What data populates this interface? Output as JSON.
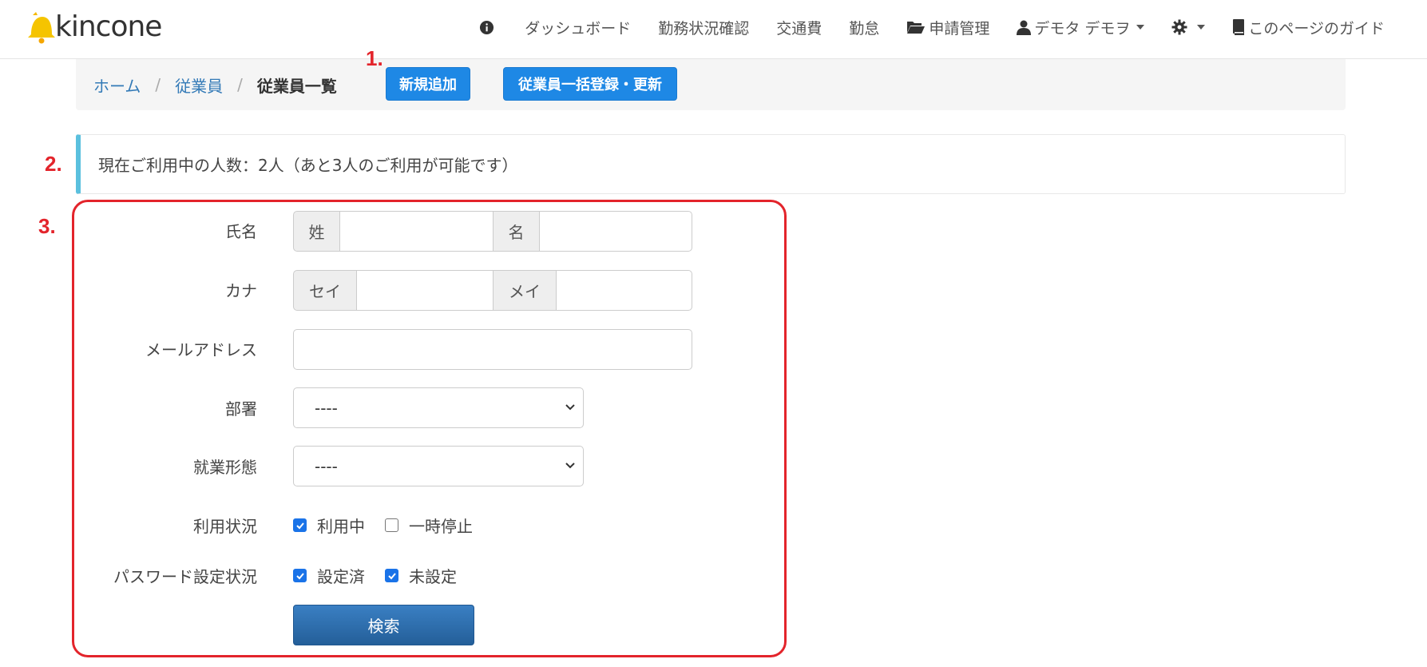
{
  "header": {
    "logo_text": "kincone",
    "nav": [
      {
        "label": ""
      },
      {
        "label": "ダッシュボード"
      },
      {
        "label": "勤務状況確認"
      },
      {
        "label": "交通費"
      },
      {
        "label": "勤怠"
      },
      {
        "label": "申請管理"
      },
      {
        "label": "デモタ デモヲ"
      },
      {
        "label": ""
      },
      {
        "label": "このページのガイド"
      }
    ]
  },
  "breadcrumb": {
    "home": "ホーム",
    "sep": "/",
    "employees": "従業員",
    "current": "従業員一覧"
  },
  "actions": {
    "new_label": "新規追加",
    "bulk_label": "従業員一括登録・更新"
  },
  "annotations": {
    "a1": "1.",
    "a2": "2.",
    "a3": "3."
  },
  "info": {
    "usage_text": "現在ご利用中の人数：2人（あと3人のご利用が可能です）"
  },
  "form": {
    "name_label": "氏名",
    "sei_addon": "姓",
    "mei_addon": "名",
    "kana_label": "カナ",
    "kana_sei_addon": "セイ",
    "kana_mei_addon": "メイ",
    "email_label": "メールアドレス",
    "dept_label": "部署",
    "dept_value": "----",
    "employment_label": "就業形態",
    "employment_value": "----",
    "status_label": "利用状況",
    "status_options": [
      {
        "label": "利用中",
        "checked": true
      },
      {
        "label": "一時停止",
        "checked": false
      }
    ],
    "password_label": "パスワード設定状況",
    "password_options": [
      {
        "label": "設定済",
        "checked": true
      },
      {
        "label": "未設定",
        "checked": true
      }
    ],
    "search_label": "検索"
  },
  "colors": {
    "accent_blue": "#1e88e5",
    "annotation_red": "#e3242b",
    "info_border": "#5bc0de",
    "search_button": "#2c6aa8"
  }
}
